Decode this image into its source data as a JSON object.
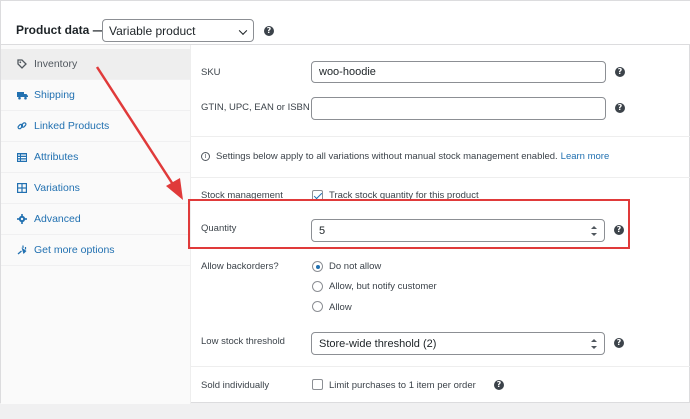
{
  "header": {
    "title": "Product data",
    "dash": "—",
    "product_type": "Variable product"
  },
  "sidebar": {
    "items": [
      {
        "label": "Inventory",
        "icon": "tag-icon"
      },
      {
        "label": "Shipping",
        "icon": "truck-icon"
      },
      {
        "label": "Linked Products",
        "icon": "link-icon"
      },
      {
        "label": "Attributes",
        "icon": "list-icon"
      },
      {
        "label": "Variations",
        "icon": "grid-icon"
      },
      {
        "label": "Advanced",
        "icon": "gear-icon"
      },
      {
        "label": "Get more options",
        "icon": "plug-icon"
      }
    ],
    "active_index": 0
  },
  "inventory": {
    "sku_label": "SKU",
    "sku_value": "woo-hoodie",
    "gtin_label": "GTIN, UPC, EAN or ISBN",
    "gtin_value": "",
    "notice_text": "Settings below apply to all variations without manual stock management enabled.",
    "notice_link": "Learn more",
    "stock_management_label": "Stock management",
    "stock_management_checkbox_label": "Track stock quantity for this product",
    "stock_management_checked": true,
    "quantity_label": "Quantity",
    "quantity_value": "5",
    "backorders_label": "Allow backorders?",
    "backorder_options": [
      "Do not allow",
      "Allow, but notify customer",
      "Allow"
    ],
    "backorder_selected": "Do not allow",
    "low_stock_label": "Low stock threshold",
    "low_stock_value": "Store-wide threshold (2)",
    "sold_individually_label": "Sold individually",
    "sold_individually_checkbox_label": "Limit purchases to 1 item per order",
    "sold_individually_checked": false
  },
  "help_glyph": "?",
  "info_glyph": "i",
  "colors": {
    "link": "#2271b1",
    "annotation": "#e03a3a",
    "tab_active_bg": "#eeeeee"
  }
}
